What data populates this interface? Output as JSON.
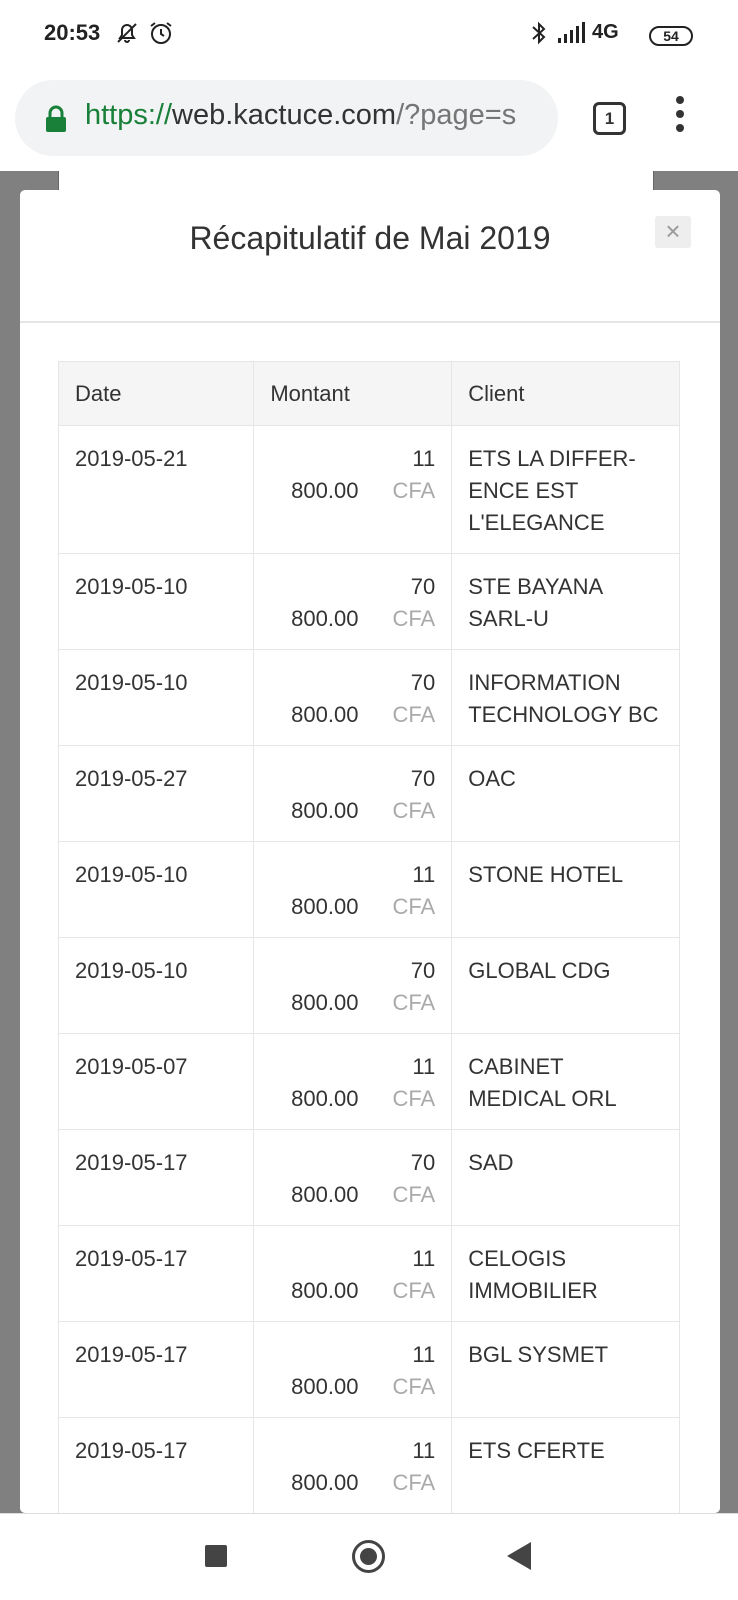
{
  "status_bar": {
    "time": "20:53",
    "network": "4G",
    "battery": "54"
  },
  "browser": {
    "url_scheme": "https://",
    "url_host": "web.kactuce.com",
    "url_path": "/?page=s",
    "tab_count": "1"
  },
  "modal": {
    "title": "Récapitulatif de Mai 2019",
    "close_label": "×",
    "columns": [
      "Date",
      "Montant",
      "Client"
    ],
    "rows": [
      {
        "date": "2019-05-21",
        "amount_top": "11",
        "amount_bottom": "800.00",
        "currency": "CFA",
        "client": "ETS LA DIFFER-ENCE EST L'ELEGANCE"
      },
      {
        "date": "2019-05-10",
        "amount_top": "70",
        "amount_bottom": "800.00",
        "currency": "CFA",
        "client": "STE BAYANA SARL-U"
      },
      {
        "date": "2019-05-10",
        "amount_top": "70",
        "amount_bottom": "800.00",
        "currency": "CFA",
        "client": "INFORMATION TECHNOLOGY BC"
      },
      {
        "date": "2019-05-27",
        "amount_top": "70",
        "amount_bottom": "800.00",
        "currency": "CFA",
        "client": "OAC"
      },
      {
        "date": "2019-05-10",
        "amount_top": "11",
        "amount_bottom": "800.00",
        "currency": "CFA",
        "client": "STONE HOTEL"
      },
      {
        "date": "2019-05-10",
        "amount_top": "70",
        "amount_bottom": "800.00",
        "currency": "CFA",
        "client": "GLOBAL CDG"
      },
      {
        "date": "2019-05-07",
        "amount_top": "11",
        "amount_bottom": "800.00",
        "currency": "CFA",
        "client": "CABINET MEDICAL ORL"
      },
      {
        "date": "2019-05-17",
        "amount_top": "70",
        "amount_bottom": "800.00",
        "currency": "CFA",
        "client": "SAD"
      },
      {
        "date": "2019-05-17",
        "amount_top": "11",
        "amount_bottom": "800.00",
        "currency": "CFA",
        "client": "CELOGIS IMMOBILIER"
      },
      {
        "date": "2019-05-17",
        "amount_top": "11",
        "amount_bottom": "800.00",
        "currency": "CFA",
        "client": "BGL SYSMET"
      },
      {
        "date": "2019-05-17",
        "amount_top": "11",
        "amount_bottom": "800.00",
        "currency": "CFA",
        "client": "ETS CFERTE"
      }
    ]
  },
  "icons": {
    "status": [
      "mute-icon",
      "alarm-icon",
      "bluetooth-icon",
      "signal-icon"
    ],
    "nav": [
      "recents-icon",
      "home-icon",
      "back-icon"
    ]
  },
  "colors": {
    "url_scheme": "#188038",
    "lock": "#188038",
    "cfa": "#aaaaaa"
  }
}
